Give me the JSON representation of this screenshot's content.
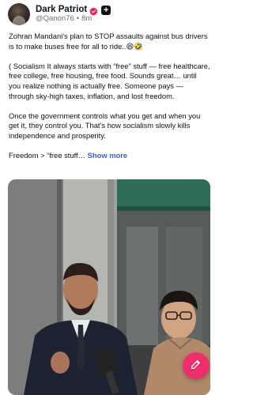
{
  "post": {
    "author": {
      "display_name": "Dark Patriot",
      "handle": "@Qanon76",
      "separator": "•",
      "time_ago": "8m",
      "plus_badge": "+",
      "verified_color": "#e0245e"
    },
    "paragraphs": [
      "Zohran Mandani's plan to STOP assaults against bus drivers is to make buses free for all to ride..😆🤣",
      "( Socialism It always starts with “free” stuff — free healthcare, free college, free housing, free food. Sounds great… until you realize nothing is actually free. Someone pays — through sky-high taxes, inflation, and lost freedom.",
      "Once the government controls what you get and when you get it, they control you. That’s how socialism slowly kills independence and prosperity."
    ],
    "truncated_text": "Freedom > “free stuff…",
    "show_more_label": "Show more",
    "media_icon": "video-thumbnail",
    "compose_icon": "compose-icon",
    "accent_color": "#ee2f6b",
    "link_color": "#3b5fd6"
  }
}
